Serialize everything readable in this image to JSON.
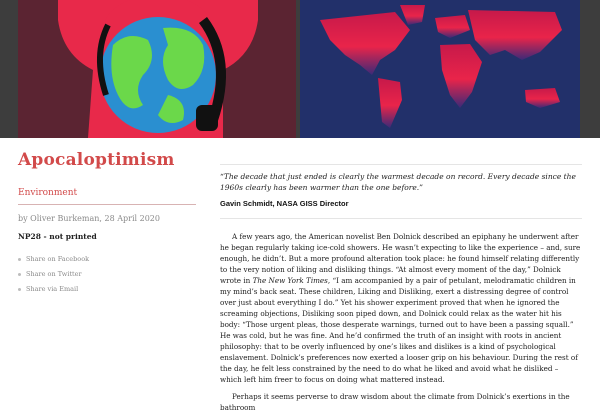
{
  "hero": {
    "left_alt_icon": "earth-headphones-illustration",
    "right_alt_icon": "warming-world-map"
  },
  "article": {
    "title": "Apocaloptimism",
    "category": "Environment",
    "byline": "by Oliver Burkeman, 28 April 2020",
    "issue": "NP28 - not printed",
    "share": [
      {
        "label": "Share on Facebook"
      },
      {
        "label": "Share on Twitter"
      },
      {
        "label": "Share via Email"
      }
    ]
  },
  "epigraph": {
    "quote": "“The decade that just ended is clearly the warmest decade on record. Every decade since the 1960s clearly has been warmer than the one before.”",
    "attribution": "Gavin Schmidt, NASA GISS Director"
  },
  "body": {
    "p1_a": "A few years ago, the American novelist Ben Dolnick described an epiphany he underwent after he began regularly taking ice-cold showers. He wasn’t expecting to like the experience – and, sure enough, he didn’t. But a more profound alteration took place: he found himself relating differently to the very notion of liking and disliking things. “At almost every moment of the day,” Dolnick wrote in ",
    "p1_pub": "The New York Times",
    "p1_b": ", “I am accompanied by a pair of petulant, melodramatic children in my mind’s back seat. These children, Liking and Disliking, exert a distressing degree of control over just about everything I do.” Yet his shower experiment proved that when he ignored the screaming objections, Disliking soon piped down, and Dolnick could relax as the water hit his body: “Those urgent pleas, those desperate warnings, turned out to have been a passing squall.” He was cold, but he was fine. And he’d confirmed the truth of an insight with roots in ancient philosophy: that to be overly influenced by one’s likes and dislikes is a kind of psychological enslavement. Dolnick’s preferences now exerted a looser grip on his behaviour. During the rest of the day, he felt less constrained by the need to do what he liked and avoid what he disliked – which left him freer to focus on doing what mattered instead.",
    "p2": "Perhaps it seems perverse to draw wisdom about the climate from Dolnick’s exertions in the bathroom"
  }
}
